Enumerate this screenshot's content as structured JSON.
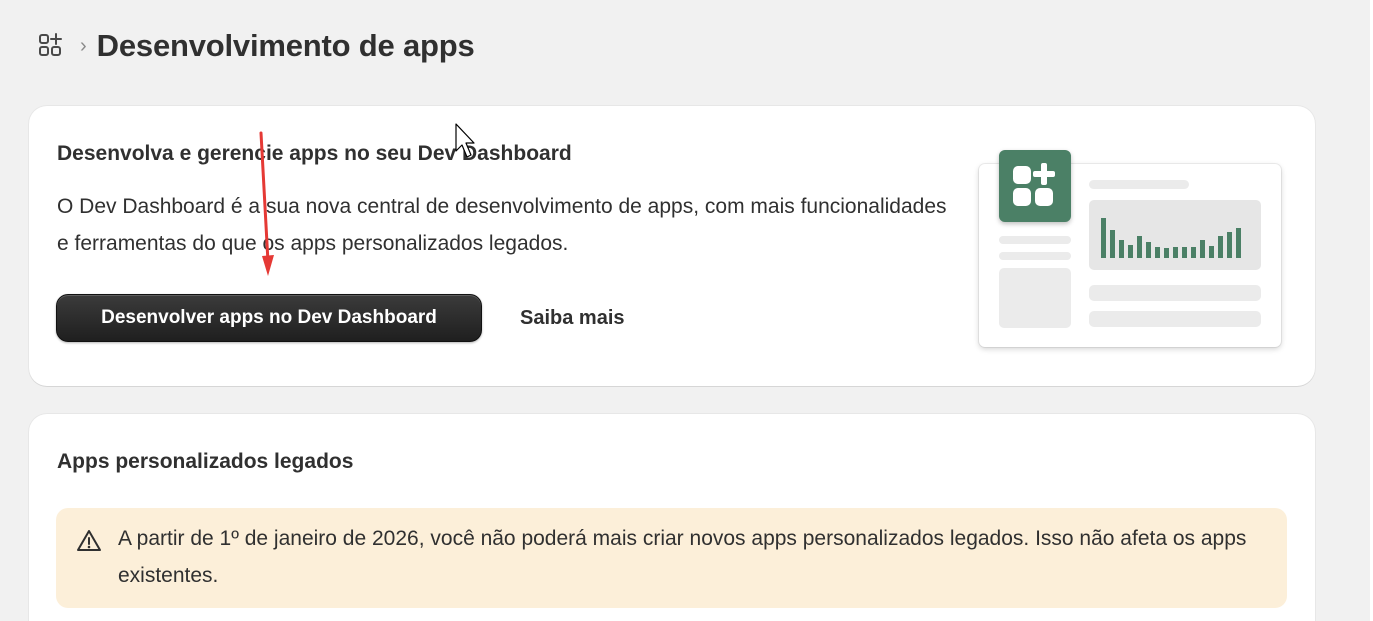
{
  "header": {
    "icon": "apps-add-icon",
    "separator": "›",
    "title": "Desenvolvimento de apps"
  },
  "dev_dashboard_card": {
    "heading": "Desenvolva e gerencie apps no seu Dev Dashboard",
    "description": "O Dev Dashboard é a sua nova central de desenvolvimento de apps, com mais funcionalidades e ferramentas do que os apps personalizados legados.",
    "primary_button": "Desenvolver apps no Dev Dashboard",
    "secondary_button": "Saiba mais",
    "illustration": "dashboard-illustration"
  },
  "legacy_card": {
    "heading": "Apps personalizados legados",
    "notice_icon": "warning-icon",
    "notice": "A partir de 1º de janeiro de 2026, você não poderá mais criar novos apps personalizados legados. Isso não afeta os apps existentes."
  },
  "colors": {
    "background": "#f1f1f1",
    "card": "#ffffff",
    "primary_button": "#2b2b2b",
    "illustration_accent": "#4b8066",
    "notice_background": "#fcefd9",
    "annotation_arrow": "#e53935"
  }
}
